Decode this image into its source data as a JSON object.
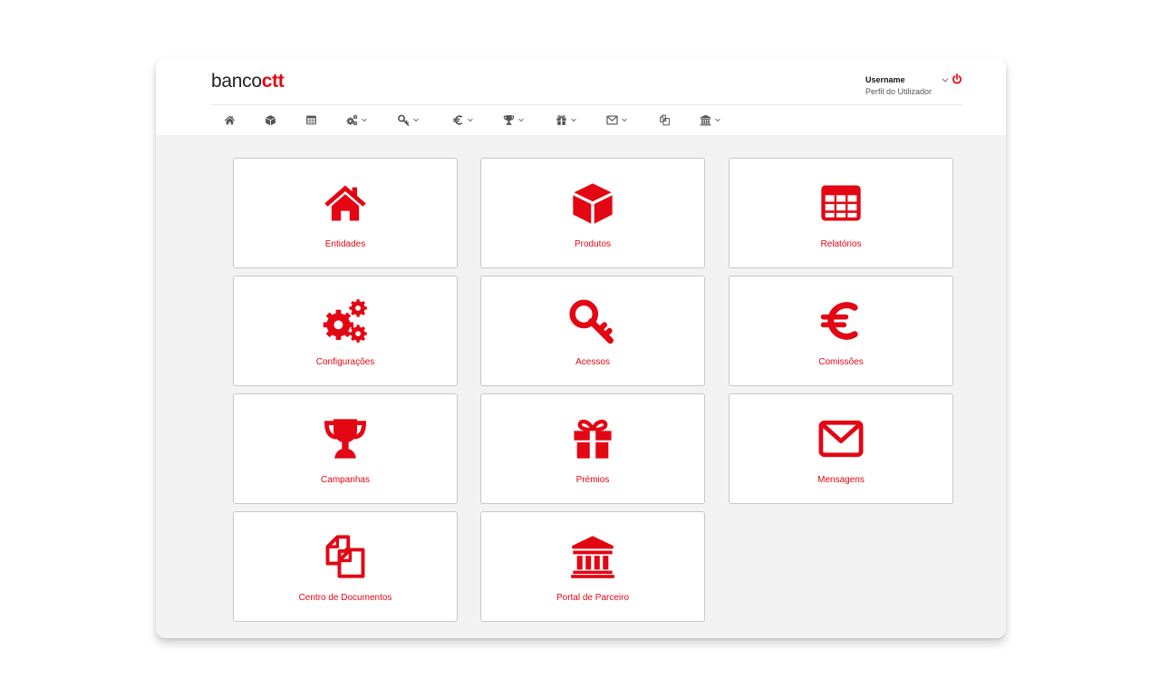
{
  "colors": {
    "brand": "#e30613",
    "nav_icon": "#555555",
    "background": "#f2f2f3"
  },
  "header": {
    "logo_prefix": "banco",
    "logo_suffix": "ctt",
    "username": "Username",
    "profile_label": "Perfil do Utilizador"
  },
  "nav": [
    {
      "icon": "home-icon"
    },
    {
      "icon": "cube-icon"
    },
    {
      "icon": "table-icon"
    },
    {
      "icon": "gears-icon",
      "dropdown": true
    },
    {
      "icon": "key-icon",
      "dropdown": true
    },
    {
      "icon": "euro-icon",
      "dropdown": true
    },
    {
      "icon": "trophy-icon",
      "dropdown": true
    },
    {
      "icon": "gift-icon",
      "dropdown": true
    },
    {
      "icon": "envelope-icon",
      "dropdown": true
    },
    {
      "icon": "documents-icon"
    },
    {
      "icon": "bank-icon",
      "dropdown": true
    }
  ],
  "tiles": [
    {
      "label": "Entidades",
      "icon": "home-icon"
    },
    {
      "label": "Produtos",
      "icon": "cube-icon"
    },
    {
      "label": "Relatórios",
      "icon": "table-icon"
    },
    {
      "label": "Configurações",
      "icon": "gears-icon"
    },
    {
      "label": "Acessos",
      "icon": "key-icon"
    },
    {
      "label": "Comissões",
      "icon": "euro-icon"
    },
    {
      "label": "Campanhas",
      "icon": "trophy-icon"
    },
    {
      "label": "Prémios",
      "icon": "gift-icon"
    },
    {
      "label": "Mensagens",
      "icon": "envelope-icon"
    },
    {
      "label": "Centro de Documentos",
      "icon": "documents-icon"
    },
    {
      "label": "Portal de Parceiro",
      "icon": "bank-icon"
    }
  ]
}
